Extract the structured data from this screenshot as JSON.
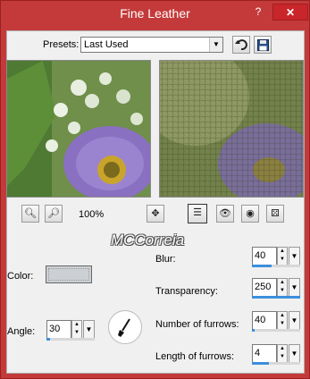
{
  "window": {
    "title": "Fine Leather",
    "help_label": "?",
    "close_label": "✕"
  },
  "presets": {
    "label": "Presets:",
    "value": "Last Used"
  },
  "zoom": {
    "level": "100%"
  },
  "watermark": "MCCorreia",
  "params": {
    "color_label": "Color:",
    "angle_label": "Angle:",
    "angle_value": "30",
    "blur_label": "Blur:",
    "blur_value": "40",
    "transparency_label": "Transparency:",
    "transparency_value": "250",
    "furrows_label": "Number of furrows:",
    "furrows_value": "40",
    "length_label": "Length of furrows:",
    "length_value": "4"
  },
  "colors": {
    "titlebar": "#c43a3a",
    "close": "#c8262a",
    "spin_fill": "#3b8fdc",
    "color_swatch": "#ccd0d4"
  }
}
